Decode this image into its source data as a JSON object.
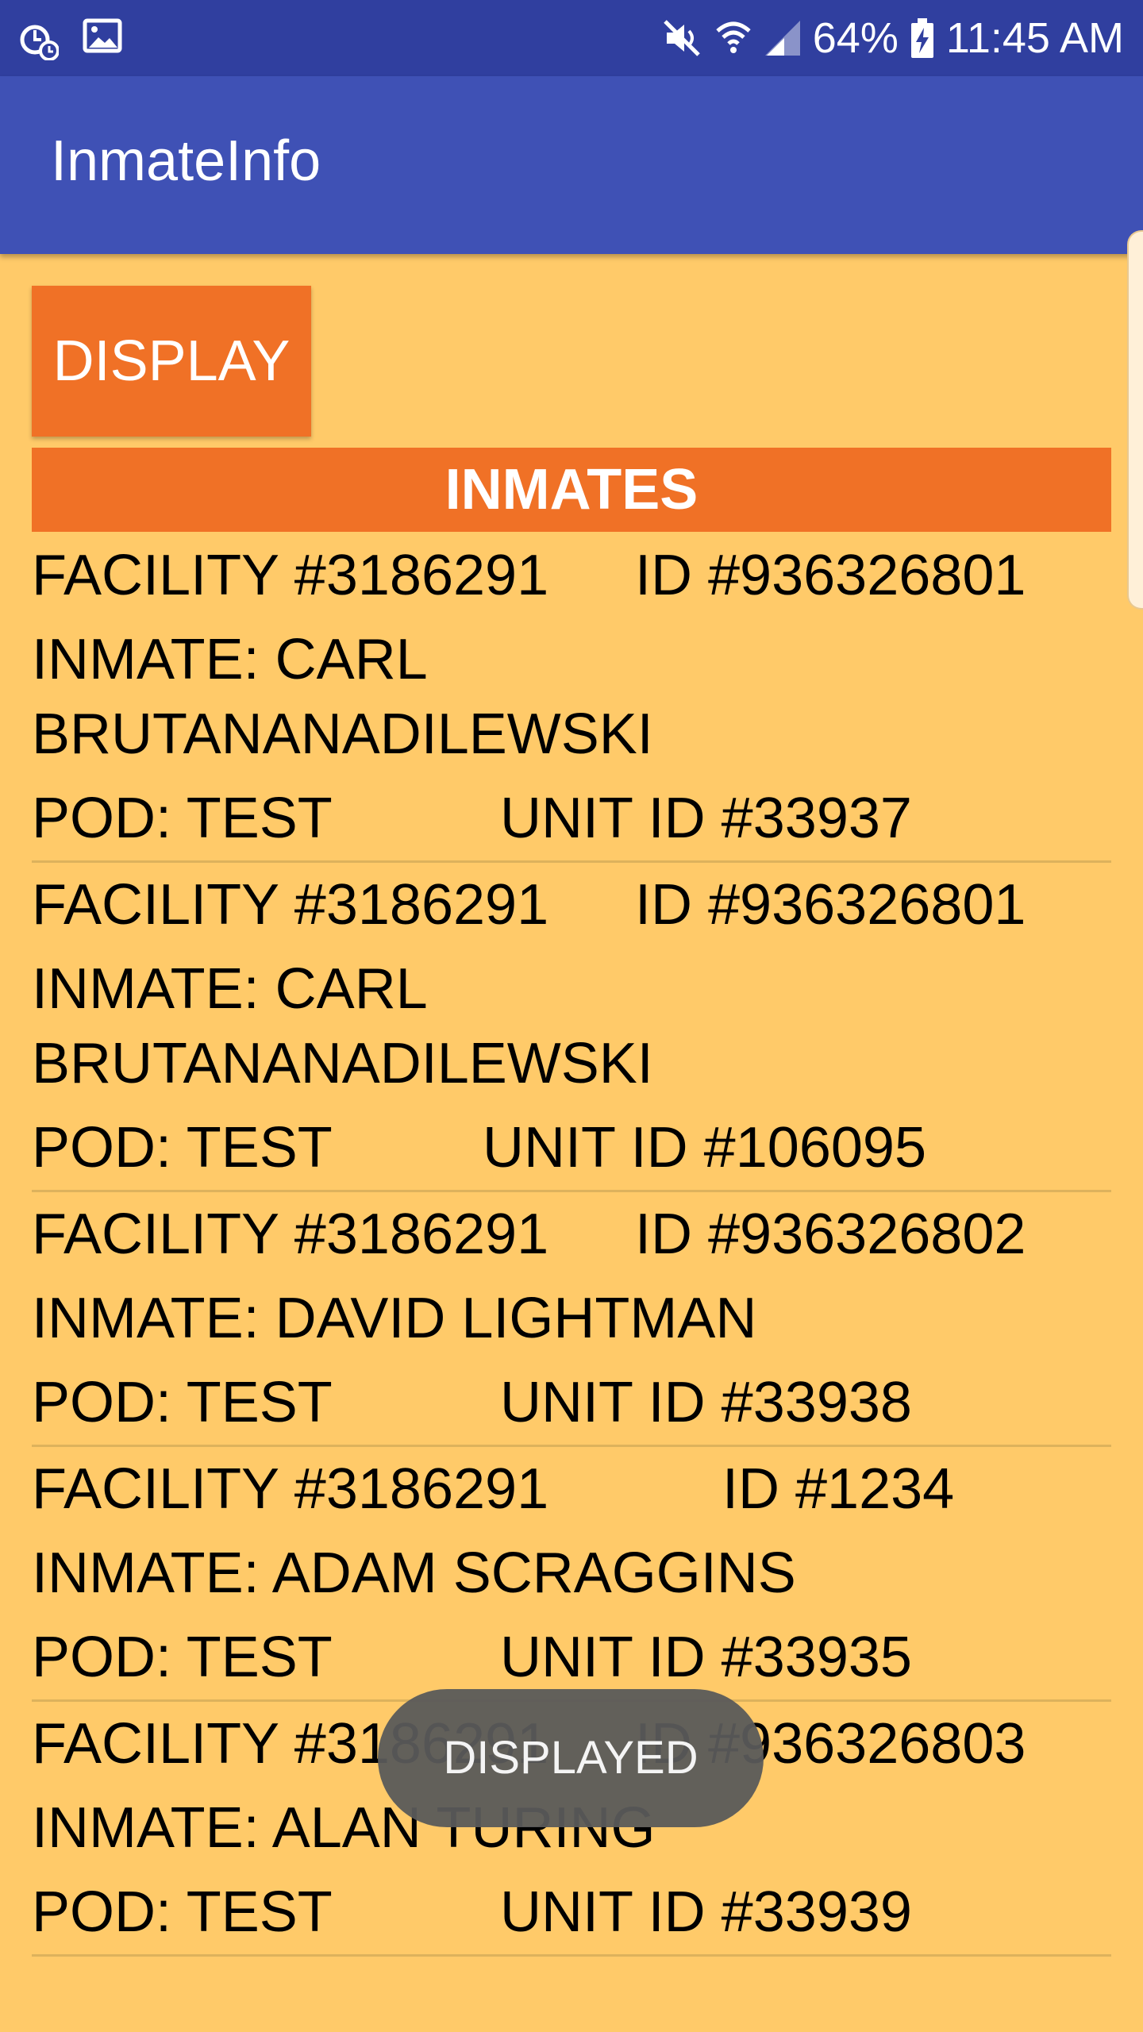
{
  "status_bar": {
    "battery": "64%",
    "time": "11:45 AM",
    "left_icons": [
      "alarm-icon",
      "image-icon"
    ],
    "right_icons": [
      "mute-icon",
      "wifi-icon",
      "signal-icon",
      "battery-icon"
    ]
  },
  "app_bar": {
    "title": "InmateInfo"
  },
  "display_button_label": "DISPLAY",
  "section_header": "INMATES",
  "inmates": [
    {
      "facility": "FACILITY #3186291",
      "id": "ID #936326801",
      "inmate": "INMATE: CARL BRUTANANADILEWSKI",
      "pod": "POD: TEST",
      "unit": "UNIT ID #33937"
    },
    {
      "facility": "FACILITY #3186291",
      "id": "ID #936326801",
      "inmate": "INMATE: CARL BRUTANANADILEWSKI",
      "pod": "POD: TEST",
      "unit": "UNIT ID #106095"
    },
    {
      "facility": "FACILITY #3186291",
      "id": "ID #936326802",
      "inmate": "INMATE: DAVID LIGHTMAN",
      "pod": "POD: TEST",
      "unit": "UNIT ID #33938"
    },
    {
      "facility": "FACILITY #3186291",
      "id": "ID #1234",
      "inmate": "INMATE: ADAM SCRAGGINS",
      "pod": "POD: TEST",
      "unit": "UNIT ID #33935"
    },
    {
      "facility": "FACILITY #3186291",
      "id": "ID #936326803",
      "inmate": "INMATE: ALAN TURING",
      "pod": "POD: TEST",
      "unit": "UNIT ID #33939"
    }
  ],
  "toast": "DISPLAYED",
  "colors": {
    "status_bar": "#303F9F",
    "app_bar": "#3F51B5",
    "background": "#FFCA69",
    "accent": "#F07126"
  }
}
